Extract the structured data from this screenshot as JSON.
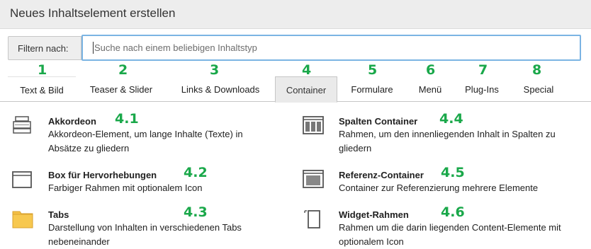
{
  "dialog": {
    "title": "Neues Inhaltselement erstellen"
  },
  "filter": {
    "label": "Filtern nach:",
    "placeholder": "Suche nach einem beliebigen Inhaltstyp"
  },
  "tabs": [
    {
      "number": "1",
      "label": "Text & Bild"
    },
    {
      "number": "2",
      "label": "Teaser & Slider"
    },
    {
      "number": "3",
      "label": "Links & Downloads"
    },
    {
      "number": "4",
      "label": "Container",
      "active": true
    },
    {
      "number": "5",
      "label": "Formulare"
    },
    {
      "number": "6",
      "label": "Menü"
    },
    {
      "number": "7",
      "label": "Plug-Ins"
    },
    {
      "number": "8",
      "label": "Special"
    }
  ],
  "items": [
    {
      "number": "4.1",
      "title": "Akkordeon",
      "desc_line1": "Akkordeon-Element, um lange Inhalte (Texte) in",
      "desc_line2": "Absätze zu gliedern",
      "icon": "accordion-icon"
    },
    {
      "number": "4.2",
      "title": "Box für Hervorhebungen",
      "desc_line1": "Farbiger Rahmen mit optionalem Icon",
      "desc_line2": "",
      "icon": "box-icon"
    },
    {
      "number": "4.3",
      "title": "Tabs",
      "desc_line1": "Darstellung von Inhalten in verschiedenen Tabs",
      "desc_line2": "nebeneinander",
      "icon": "folder-icon"
    },
    {
      "number": "4.4",
      "title": "Spalten Container",
      "desc_line1": "Rahmen, um den innenliegenden Inhalt in Spalten zu",
      "desc_line2": "gliedern",
      "icon": "columns-icon"
    },
    {
      "number": "4.5",
      "title": "Referenz-Container",
      "desc_line1": "Container zur Referenzierung mehrere Elemente",
      "desc_line2": "",
      "icon": "reference-container-icon"
    },
    {
      "number": "4.6",
      "title": "Widget-Rahmen",
      "desc_line1": "Rahmen um die darin liegenden Content-Elemente mit",
      "desc_line2": "optionalem Icon",
      "icon": "widget-frame-icon"
    }
  ],
  "colors": {
    "accent_number": "#1aa84a",
    "focus_border": "#7bb4e3",
    "folder": "#f5c046"
  }
}
